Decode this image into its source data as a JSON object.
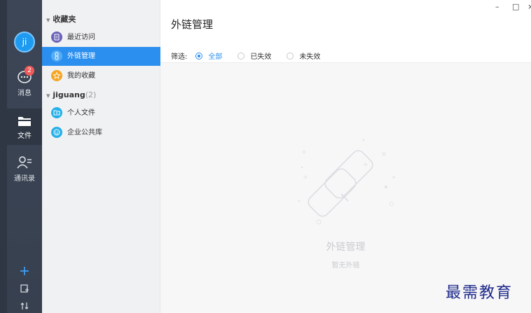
{
  "rail": {
    "avatar_initials": "ji",
    "messages": {
      "label": "消息",
      "badge": "2"
    },
    "files": {
      "label": "文件"
    },
    "contacts": {
      "label": "通讯录"
    }
  },
  "sidebar": {
    "favorites_header": "收藏夹",
    "favorites": [
      {
        "label": "最近访问",
        "icon": "recent-doc-icon",
        "color": "#6a62b8"
      },
      {
        "label": "外链管理",
        "icon": "link-icon",
        "color": "#2b8ff0"
      },
      {
        "label": "我的收藏",
        "icon": "star-icon",
        "color": "#f5a623"
      }
    ],
    "account_header": "jiguang",
    "account_count": "(2)",
    "account_items": [
      {
        "label": "个人文件",
        "icon": "personal-folder-icon",
        "color": "#25b0e8"
      },
      {
        "label": "企业公共库",
        "icon": "enterprise-library-icon",
        "color": "#25b0e8"
      }
    ]
  },
  "main": {
    "title": "外链管理",
    "filter_label": "筛选:",
    "filters": [
      {
        "label": "全部",
        "selected": true
      },
      {
        "label": "已失效",
        "selected": false
      },
      {
        "label": "未失效",
        "selected": false
      }
    ],
    "empty_title": "外链管理",
    "empty_subtitle": "暂无外链"
  },
  "window": {
    "minimize": "–",
    "maximize": "□",
    "close": "×"
  },
  "watermark": "最需教育",
  "colors": {
    "accent": "#2b8ff0",
    "rail": "#3a4353",
    "sidebar": "#f0f1f3",
    "badge": "#f05a5a"
  }
}
